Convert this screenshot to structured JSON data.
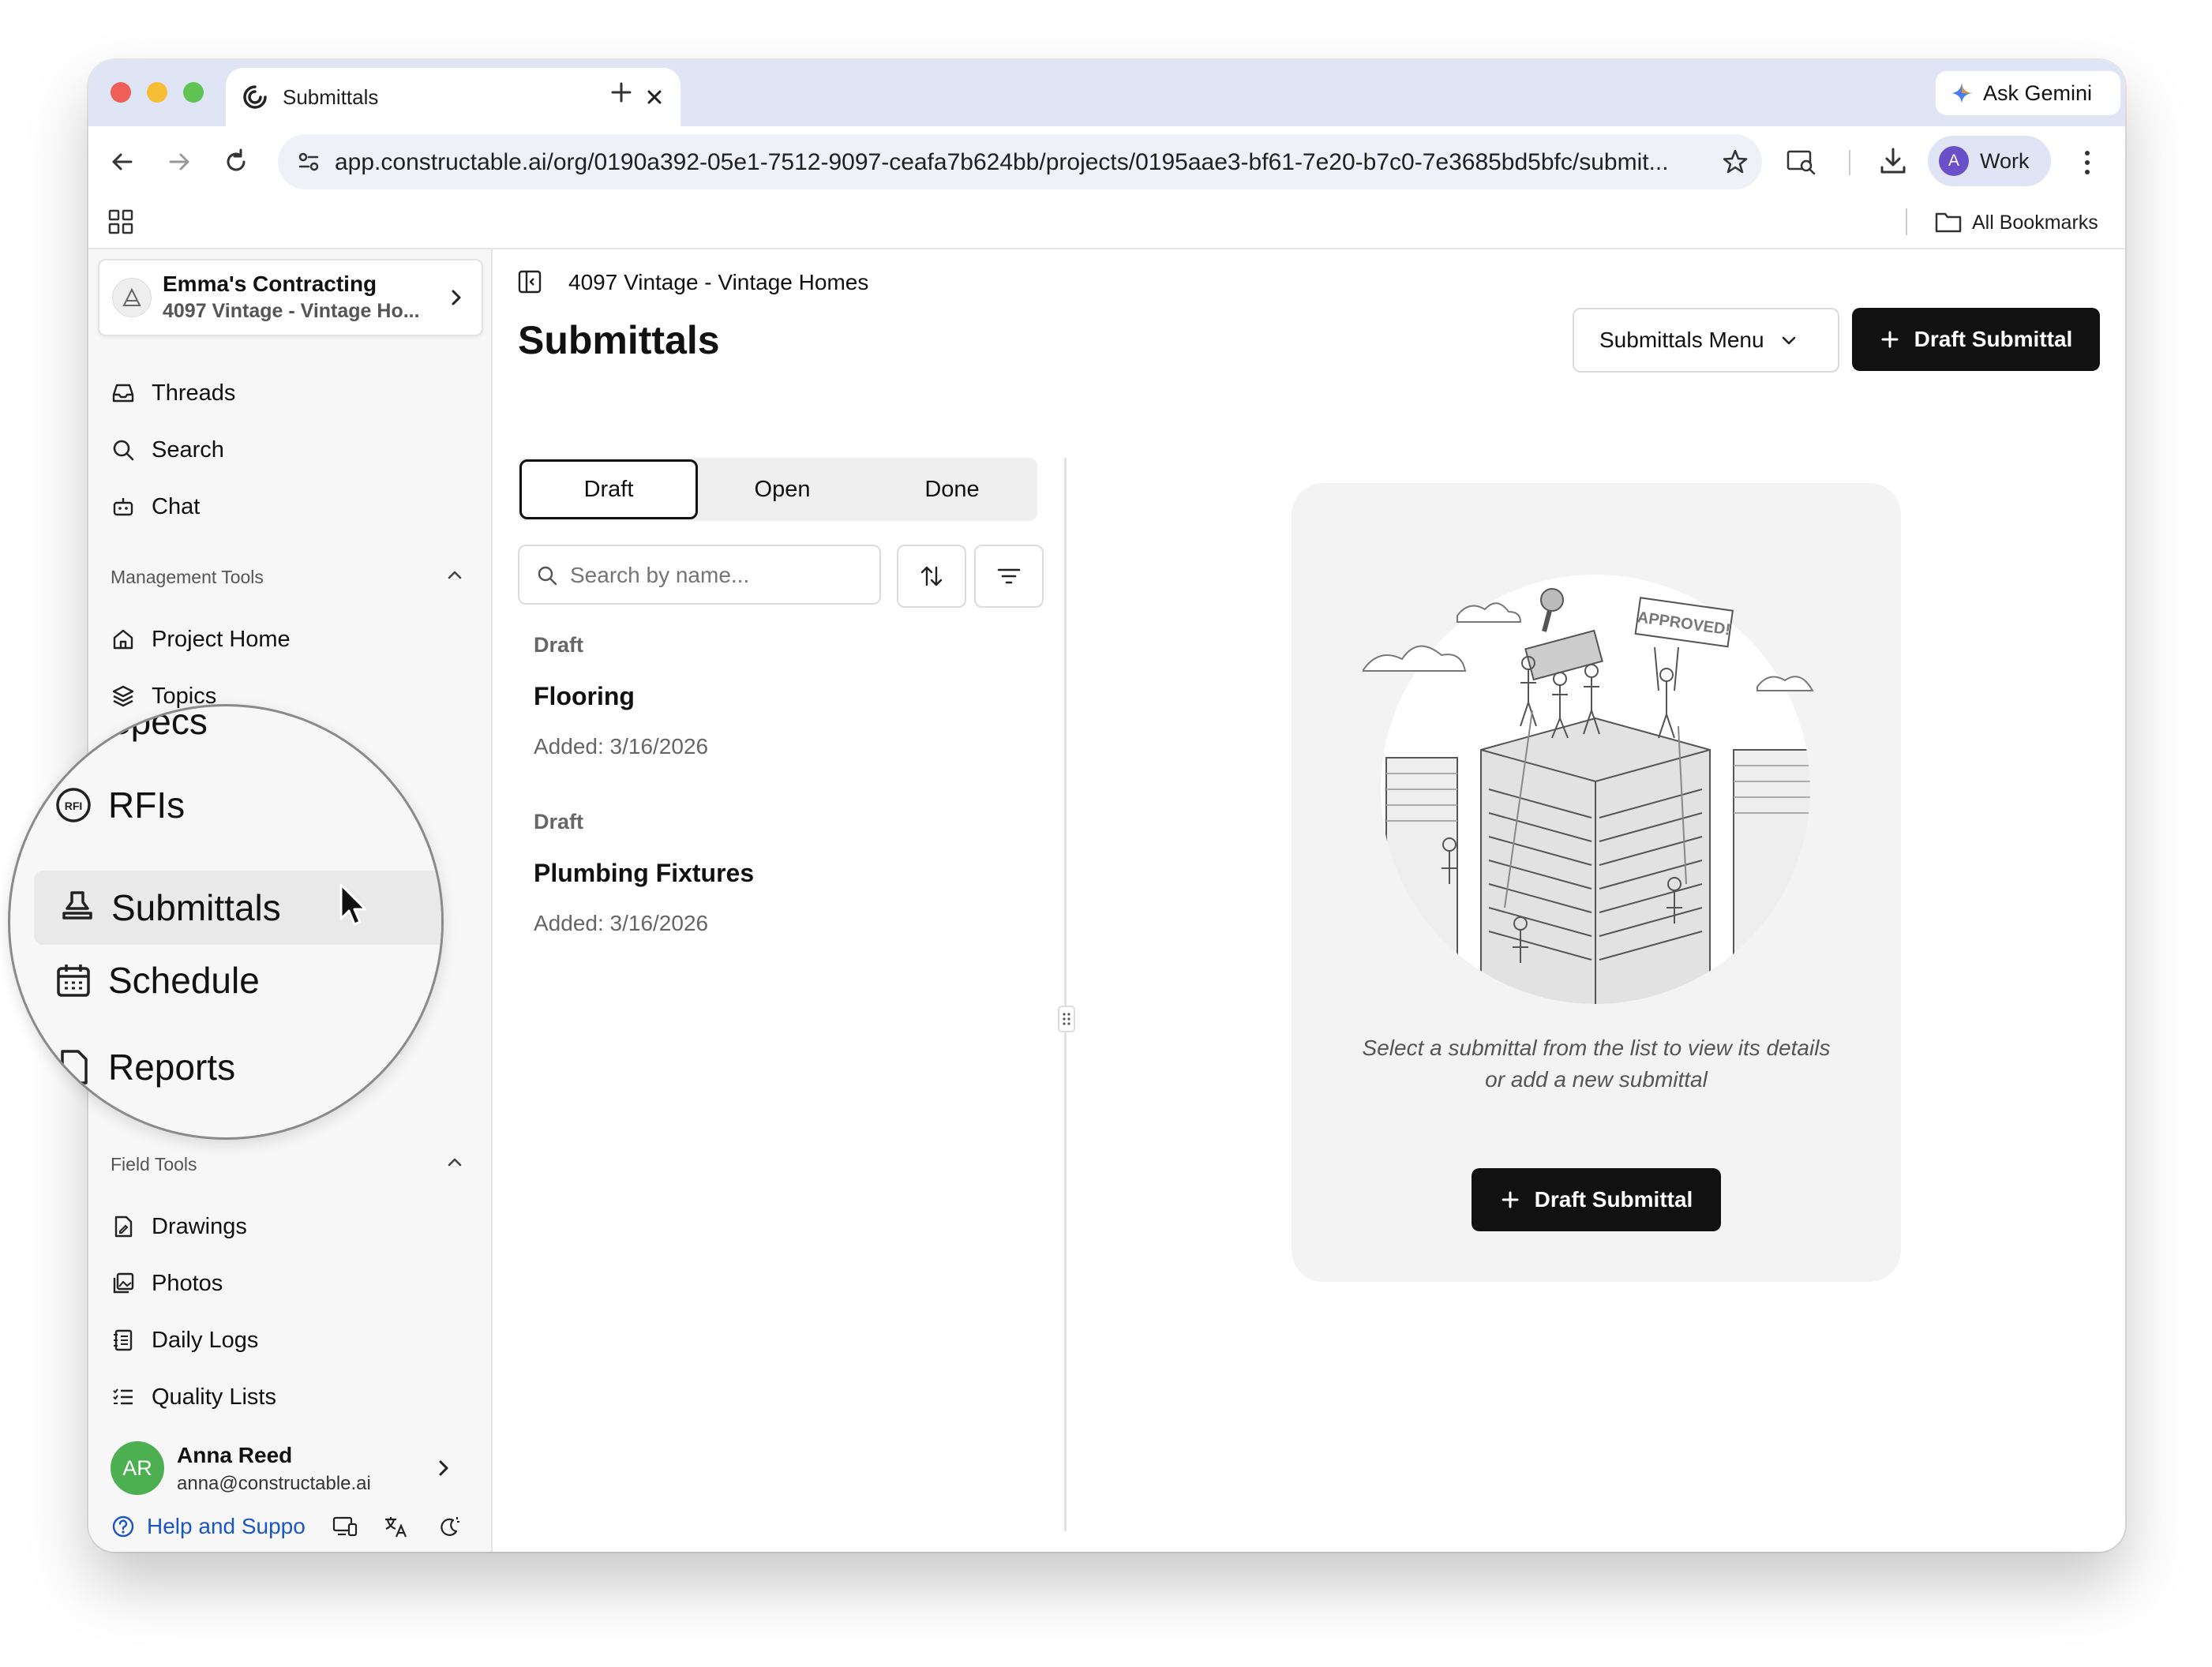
{
  "browser": {
    "tab_title": "Submittals",
    "url": "app.constructable.ai/org/0190a392-05e1-7512-9097-ceafa7b624bb/projects/0195aae3-bf61-7e20-b7c0-7e3685bd5bfc/submit...",
    "ask_gemini": "Ask Gemini",
    "profile_initial": "A",
    "profile_name": "Work",
    "all_bookmarks": "All Bookmarks"
  },
  "sidebar": {
    "org_name": "Emma's Contracting",
    "org_project": "4097 Vintage - Vintage Ho...",
    "top_items": [
      "Threads",
      "Search",
      "Chat"
    ],
    "management_label": "Management Tools",
    "management_items": [
      "Project Home",
      "Topics"
    ],
    "magnified_items": [
      "Specs",
      "RFIs",
      "Submittals",
      "Schedule",
      "Reports"
    ],
    "field_label": "Field Tools",
    "field_items": [
      "Drawings",
      "Photos",
      "Daily Logs",
      "Quality Lists"
    ],
    "user": {
      "initials": "AR",
      "name": "Anna Reed",
      "email": "anna@constructable.ai"
    },
    "help_label": "Help and Suppo"
  },
  "header": {
    "breadcrumb": "4097 Vintage - Vintage Homes",
    "title": "Submittals",
    "menu_button": "Submittals Menu",
    "draft_button": "Draft Submittal"
  },
  "list": {
    "tabs": [
      "Draft",
      "Open",
      "Done"
    ],
    "active_tab": "Draft",
    "search_placeholder": "Search by name...",
    "items": [
      {
        "status": "Draft",
        "title": "Flooring",
        "added": "Added: 3/16/2026"
      },
      {
        "status": "Draft",
        "title": "Plumbing Fixtures",
        "added": "Added: 3/16/2026"
      }
    ]
  },
  "empty_state": {
    "stamp_text": "APPROVED!",
    "line1": "Select a submittal from the list to view its details",
    "line2": "or add a new submittal",
    "button": "Draft Submittal"
  },
  "colors": {
    "accent": "#111111",
    "avatar_green": "#4caf50",
    "profile_purple": "#6b4fc9",
    "help_blue": "#1a56c4"
  }
}
